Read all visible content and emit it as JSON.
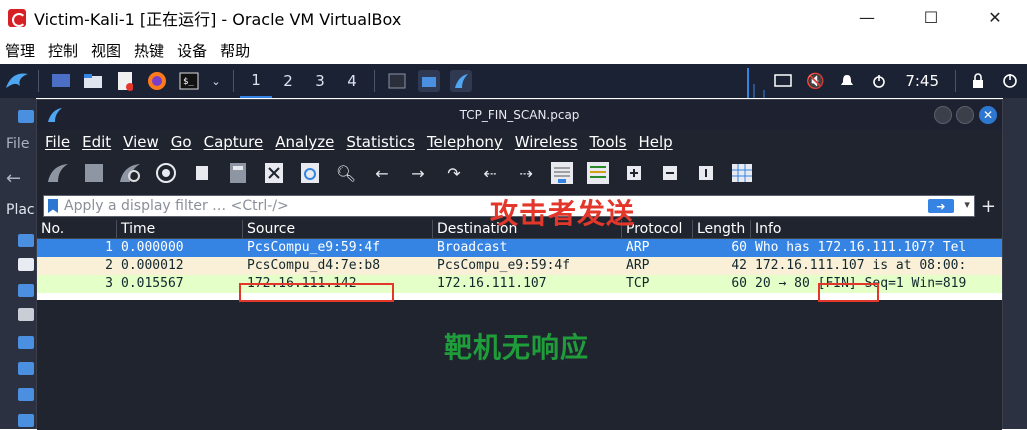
{
  "host": {
    "title": "Victim-Kali-1 [正在运行] - Oracle VM VirtualBox",
    "minimize": "—",
    "maximize": "☐",
    "close": "✕"
  },
  "vbox_menu": [
    "管理",
    "控制",
    "视图",
    "热键",
    "设备",
    "帮助"
  ],
  "kali_panel": {
    "workspaces": [
      "1",
      "2",
      "3",
      "4"
    ],
    "time": "7:45"
  },
  "desktop": {
    "file_label": "File",
    "places_label": "Plac"
  },
  "wireshark": {
    "title": "TCP_FIN_SCAN.pcap",
    "menu": [
      "File",
      "Edit",
      "View",
      "Go",
      "Capture",
      "Analyze",
      "Statistics",
      "Telephony",
      "Wireless",
      "Tools",
      "Help"
    ],
    "filter_placeholder": "Apply a display filter … <Ctrl-/>",
    "columns": [
      "No.",
      "Time",
      "Source",
      "Destination",
      "Protocol",
      "Length",
      "Info"
    ],
    "packets": [
      {
        "no": "1",
        "time": "0.000000",
        "source": "PcsCompu_e9:59:4f",
        "destination": "Broadcast",
        "protocol": "ARP",
        "length": "60",
        "info": "Who has 172.16.111.107? Tel"
      },
      {
        "no": "2",
        "time": "0.000012",
        "source": "PcsCompu_d4:7e:b8",
        "destination": "PcsCompu_e9:59:4f",
        "protocol": "ARP",
        "length": "42",
        "info": "172.16.111.107 is at 08:00:"
      },
      {
        "no": "3",
        "time": "0.015567",
        "source": "172.16.111.142",
        "destination": "172.16.111.107",
        "protocol": "TCP",
        "length": "60",
        "info_prefix": "20 → 80 ",
        "info_flag": "[FIN]",
        "info_suffix": " Seq=1 Win=819"
      }
    ]
  },
  "annotations": {
    "attacker": "攻击者发送",
    "target": "靶机无响应"
  },
  "colors": {
    "selected_row": "#3584e4",
    "arp_row": "#faf0d7",
    "tcp_row": "#e4ffc7",
    "annotation_red": "#e3372b",
    "annotation_green": "#1f9d3a"
  }
}
